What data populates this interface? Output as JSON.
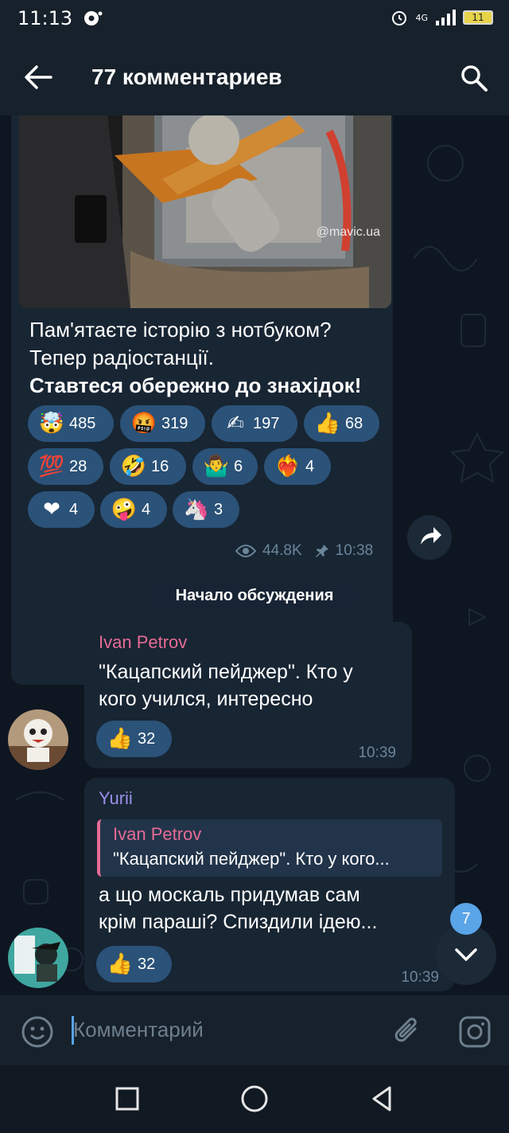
{
  "status_bar": {
    "time": "11:13",
    "network": "4G",
    "battery": "11"
  },
  "header": {
    "title": "77 комментариев"
  },
  "post": {
    "watermark": "@mavic.ua",
    "text_lines": [
      "Пам'ятаєте історію з нотбуком?",
      "Тепер радіостанції.",
      "Ставтеся обережно до знахідок!"
    ],
    "reactions": [
      {
        "emoji": "🤯",
        "count": "485"
      },
      {
        "emoji": "🤬",
        "count": "319"
      },
      {
        "emoji": "✍",
        "count": "197"
      },
      {
        "emoji": "👍",
        "count": "68"
      },
      {
        "emoji": "💯",
        "count": "28"
      },
      {
        "emoji": "🤣",
        "count": "16"
      },
      {
        "emoji": "🤷‍♂️",
        "count": "6"
      },
      {
        "emoji": "❤‍🔥",
        "count": "4"
      },
      {
        "emoji": "❤",
        "count": "4"
      },
      {
        "emoji": "🤪",
        "count": "4"
      },
      {
        "emoji": "🦄",
        "count": "3"
      }
    ],
    "views": "44.8K",
    "time": "10:38"
  },
  "discussion_start": "Начало обсуждения",
  "comments": [
    {
      "author": "Ivan Petrov",
      "author_color": "#e66b95",
      "text_lines": [
        "\"Кацапский пейджер\". Кто у",
        "кого учился, интересно"
      ],
      "reaction": {
        "emoji": "👍",
        "count": "32"
      },
      "time": "10:39"
    },
    {
      "author": "Yurii",
      "author_color": "#9b8fe8",
      "reply_to": {
        "author": "Ivan Petrov",
        "text": "\"Кацапский пейджер\". Кто у кого..."
      },
      "text_lines": [
        "а що москаль придумав сам",
        "крім параші? Спиздили ідею..."
      ],
      "reaction": {
        "emoji": "👍",
        "count": "32"
      },
      "time": "10:39"
    }
  ],
  "unread_count": "7",
  "composer": {
    "placeholder": "Комментарий"
  },
  "colors": {
    "background": "#0e1621",
    "bubble": "#182533",
    "bar": "#17212b",
    "reaction": "#2b5278",
    "accent": "#5aa4e8"
  }
}
